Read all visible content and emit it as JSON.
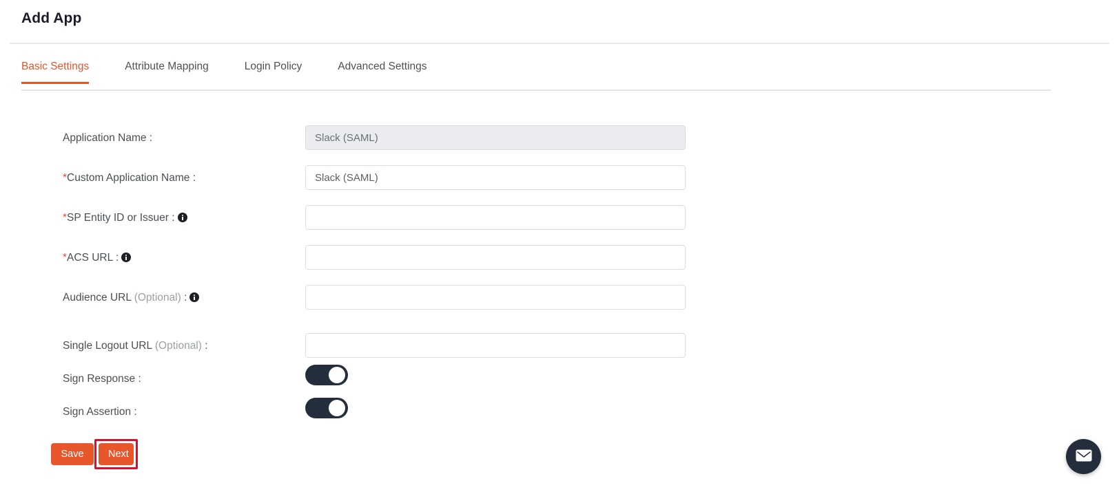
{
  "header": {
    "title": "Add App"
  },
  "tabs": [
    {
      "label": "Basic Settings",
      "active": true
    },
    {
      "label": "Attribute Mapping",
      "active": false
    },
    {
      "label": "Login Policy",
      "active": false
    },
    {
      "label": "Advanced Settings",
      "active": false
    }
  ],
  "form": {
    "fields": [
      {
        "label": "Application Name",
        "required": false,
        "optional": false,
        "info": false,
        "value": "Slack (SAML)",
        "disabled": true,
        "type": "text"
      },
      {
        "label": "Custom Application Name",
        "required": true,
        "optional": false,
        "info": false,
        "value": "Slack (SAML)",
        "disabled": false,
        "type": "text"
      },
      {
        "label": "SP Entity ID or Issuer",
        "required": true,
        "optional": false,
        "info": true,
        "value": "",
        "disabled": false,
        "type": "text"
      },
      {
        "label": "ACS URL",
        "required": true,
        "optional": false,
        "info": true,
        "value": "",
        "disabled": false,
        "type": "text"
      },
      {
        "label": "Audience URL",
        "required": false,
        "optional": true,
        "info": true,
        "value": "",
        "disabled": false,
        "type": "text"
      },
      {
        "label": "Single Logout URL",
        "required": false,
        "optional": true,
        "info": false,
        "value": "",
        "disabled": false,
        "type": "text"
      },
      {
        "label": "Sign Response",
        "required": false,
        "optional": false,
        "info": false,
        "value": "on",
        "disabled": false,
        "type": "toggle"
      },
      {
        "label": "Sign Assertion",
        "required": false,
        "optional": false,
        "info": false,
        "value": "on",
        "disabled": false,
        "type": "toggle"
      }
    ],
    "optional_text": "(Optional)",
    "colon": ":",
    "required_marker": "*"
  },
  "actions": {
    "save_label": "Save",
    "next_label": "Next",
    "highlighted": "next-button"
  },
  "fab": {
    "icon": "envelope-icon"
  },
  "colors": {
    "accent": "#e2562a",
    "button": "#e8562c",
    "toggle_on": "#232d3b",
    "highlight": "#d8102a",
    "label_text": "#4a4f54",
    "required": "#e04a4a",
    "optional": "#9aa0a6",
    "divider": "#e6e7e9",
    "disabled_field_bg": "#eaecef"
  }
}
